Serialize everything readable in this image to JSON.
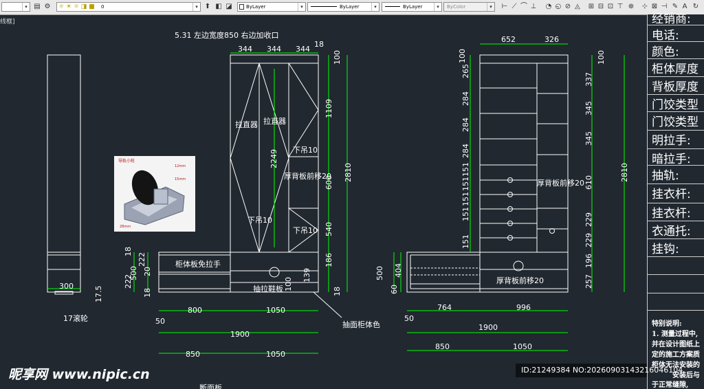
{
  "toolbar": {
    "layer_value": "0",
    "color_value": "ByLayer",
    "linetype_value": "ByLayer",
    "lineweight_value": "ByLayer",
    "plotstyle_value": "ByColor"
  },
  "viewport_label": "线框]",
  "title_note": "5.31 左边宽度850  右边加收口",
  "labels": {
    "lazhiqi1": "拉直器",
    "lazhiqi2": "拉直器",
    "xiadiao_top": "下吊10",
    "xiadiao_left": "下吊10",
    "xiadiao_right": "下吊10",
    "houbei_mid": "厚背板前移20",
    "guiti_lashou": "柜体板免拉手",
    "choula": "抽拉鞋板",
    "choumian": "抽面柜体色",
    "gunlun": "17滚轮",
    "houbei_right": "厚背板前移20",
    "houbei_bottom": "厚背板前移20",
    "photo_caption": "导轨小轮",
    "photo_dim1": "12mm",
    "photo_dim2": "15mm",
    "photo_dim3": "28mm",
    "bottom_partial": "断面板"
  },
  "dims": {
    "side_w": "300",
    "side_h": "17.5",
    "mid_top": [
      "344",
      "344",
      "344"
    ],
    "mid_top_gap": "18",
    "mid_right": [
      "100",
      "1109",
      "600",
      "540",
      "186",
      "18"
    ],
    "mid_total": "2810",
    "mid_center": "2249",
    "mid_left": [
      "18",
      "222",
      "500",
      "222",
      "20",
      "18"
    ],
    "mid_bottom_139": "139",
    "mid_bottom_100": "100",
    "mid_row1": [
      "800",
      "1050"
    ],
    "mid_row1_left": "50",
    "mid_row2": "1900",
    "mid_row3": [
      "850",
      "1050"
    ],
    "right_top": [
      "652",
      "326"
    ],
    "right_left": [
      "100",
      "265",
      "284",
      "284",
      "284",
      "151",
      "151",
      "151",
      "151",
      "151"
    ],
    "right_right": [
      "100",
      "337",
      "345",
      "345",
      "610",
      "229",
      "229",
      "196",
      "257"
    ],
    "right_total": "2810",
    "right_low": [
      "500",
      "404",
      "60"
    ],
    "right_row1": [
      "764",
      "996"
    ],
    "right_row1_left": "50",
    "right_row2": "1900",
    "right_row3": [
      "850",
      "1050"
    ]
  },
  "right_panel": {
    "rows": [
      "经销商:",
      "电话:",
      "颜色:",
      "柜体厚度",
      "背板厚度",
      "门饺类型",
      "门饺类型",
      "明拉手:",
      "暗拉手:",
      "抽轨:",
      "挂衣杆:",
      "挂衣杆:",
      "衣通托:",
      "挂钩:"
    ],
    "notes_title": "特别说明:",
    "notes": [
      "1. 测量过程中,",
      "并在设计图纸上",
      "定的施工方案质",
      "柜体无法安装的",
      "安装后与",
      "于正常缝隙,"
    ]
  },
  "watermark": {
    "brand": "昵享网 www.nipic.cn",
    "id": "ID:21249384 NO:20260903143216046104"
  },
  "colors": {
    "background": "#212830",
    "cad_white": "#ffffff",
    "dim_green": "#00ff00",
    "toolbar": "#e8e8e8"
  }
}
